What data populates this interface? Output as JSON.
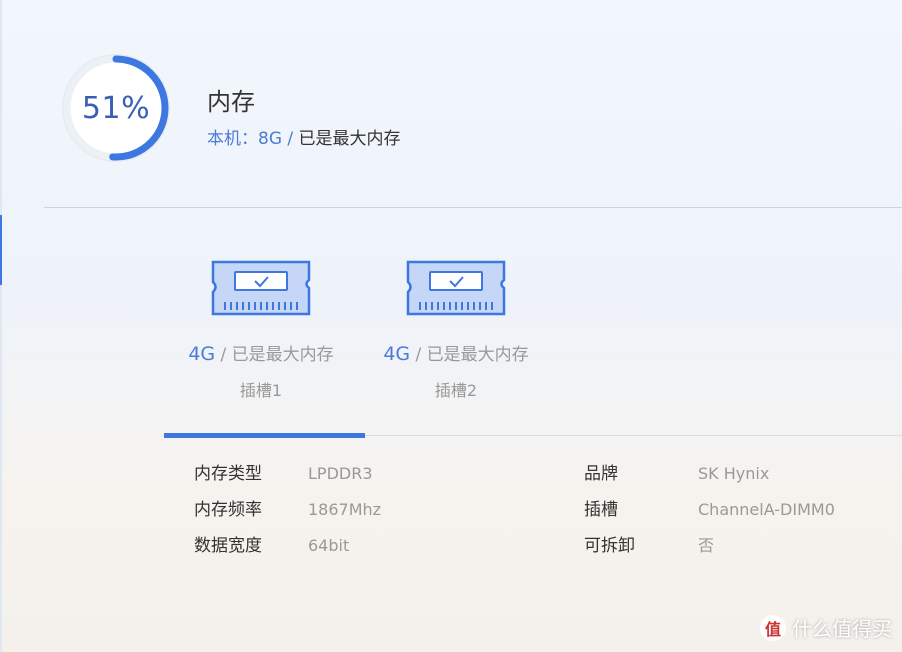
{
  "gauge": {
    "percent": 51,
    "label": "51%"
  },
  "memory": {
    "title": "内存",
    "subtitle_capacity": "本机：8G /",
    "subtitle_status": "已是最大内存"
  },
  "slots": [
    {
      "size": "4G",
      "status": "/ 已是最大内存",
      "name": "插槽1"
    },
    {
      "size": "4G",
      "status": "/ 已是最大内存",
      "name": "插槽2"
    }
  ],
  "specs_left": [
    {
      "key": "内存类型",
      "value": "LPDDR3"
    },
    {
      "key": "内存频率",
      "value": "1867Mhz"
    },
    {
      "key": "数据宽度",
      "value": "64bit"
    }
  ],
  "specs_right": [
    {
      "key": "品牌",
      "value": "SK Hynix"
    },
    {
      "key": "插槽",
      "value": "ChannelA-DIMM0"
    },
    {
      "key": "可拆卸",
      "value": "否"
    }
  ],
  "watermark": {
    "text": "什么值得买",
    "logo": "值"
  },
  "colors": {
    "accent": "#3c78e0",
    "value_blue": "#4c7ad6"
  }
}
